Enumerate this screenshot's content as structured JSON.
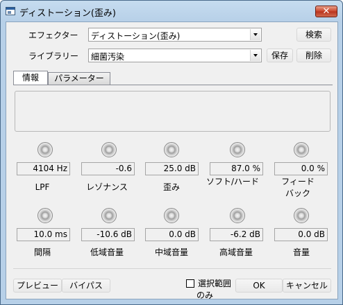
{
  "window": {
    "title": "ディストーション(歪み)",
    "close_label": "✕"
  },
  "effector": {
    "label": "エフェクター",
    "value": "ディストーション(歪み)",
    "search_label": "検索"
  },
  "library": {
    "label": "ライブラリー",
    "value": "細菌汚染",
    "save_label": "保存",
    "delete_label": "削除"
  },
  "tabs": [
    {
      "label": "情報"
    },
    {
      "label": "パラメーター"
    }
  ],
  "params_row1": [
    {
      "value": "4104 Hz",
      "label": "LPF"
    },
    {
      "value": "-0.6",
      "label": "レゾナンス"
    },
    {
      "value": "25.0 dB",
      "label": "歪み"
    },
    {
      "value": "87.0 %",
      "label": "ソフト/ハード"
    },
    {
      "value": "0.0 %",
      "label": "フィード バック"
    }
  ],
  "params_row2": [
    {
      "value": "10.0 ms",
      "label": "間隔"
    },
    {
      "value": "-10.6 dB",
      "label": "低域音量"
    },
    {
      "value": "0.0 dB",
      "label": "中域音量"
    },
    {
      "value": "-6.2 dB",
      "label": "高域音量"
    },
    {
      "value": "0.0 dB",
      "label": "音量"
    }
  ],
  "footer": {
    "preview_label": "プレビュー",
    "bypass_label": "バイパス",
    "selection_only_label_line1": "選択範囲",
    "selection_only_label_line2": "のみ",
    "ok_label": "OK",
    "cancel_label": "キャンセル"
  }
}
